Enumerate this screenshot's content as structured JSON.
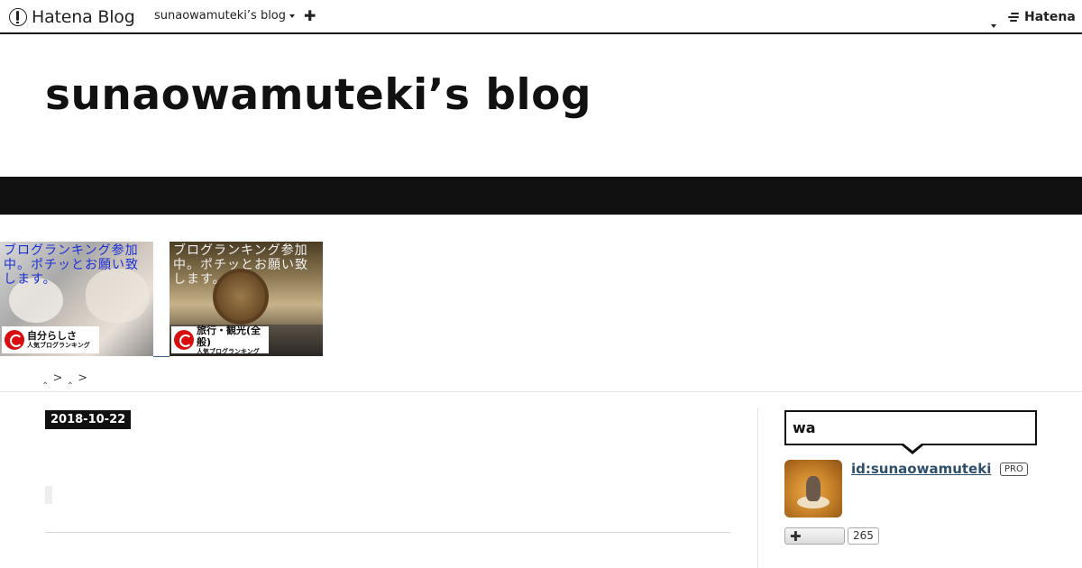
{
  "global_header": {
    "logo_text": "Hatena Blog",
    "blog_menu_label": "sunaowamuteki’s blog",
    "new_entry_icon": "plus-icon",
    "hatena_logo_text": "Hatena"
  },
  "blog": {
    "title": "sunaowamuteki’s blog"
  },
  "banners": [
    {
      "text": "ブログランキング参加中。ポチッとお願い致します。",
      "badge_main": "自分らしさ",
      "badge_sub": "人気ブログランキング"
    },
    {
      "text": "ブログランキング参加中。ポチッとお願い致します。",
      "badge_main": "旅行・観光(全般)",
      "badge_sub": "人気ブログランキング"
    }
  ],
  "breadcrumbs": "‸ >  ‸ >",
  "entry": {
    "date": "2018-10-22"
  },
  "sidebar": {
    "balloon_text": "wa",
    "user_id": "id:sunaowamuteki",
    "pro_label": "PRO",
    "follow_icon": "plus-icon",
    "follower_count": "265"
  },
  "colors": {
    "dark_band": "#111111",
    "user_link": "#2e4f6b",
    "banner_text_1": "#1a2fd6",
    "banner_text_2": "#f2f2f2",
    "ranking_red": "#d90f0f"
  }
}
